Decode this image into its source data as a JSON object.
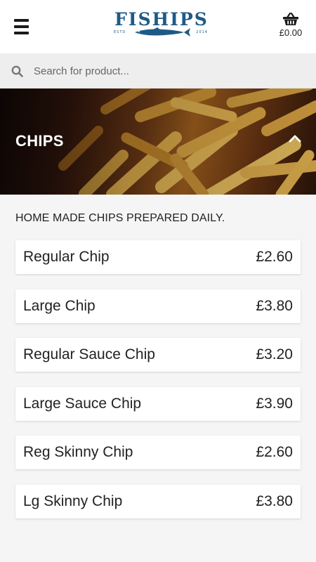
{
  "header": {
    "logo": {
      "name": "FISHIPS",
      "est": "ESTD",
      "year": "2014"
    },
    "cart_total": "£0.00"
  },
  "search": {
    "placeholder": "Search for product..."
  },
  "category": {
    "title": "CHIPS",
    "description": "HOME MADE CHIPS PREPARED DAILY."
  },
  "products": [
    {
      "name": "Regular Chip",
      "price": "£2.60"
    },
    {
      "name": "Large Chip",
      "price": "£3.80"
    },
    {
      "name": "Regular Sauce Chip",
      "price": "£3.20"
    },
    {
      "name": "Large Sauce Chip",
      "price": "£3.90"
    },
    {
      "name": "Reg Skinny Chip",
      "price": "£2.60"
    },
    {
      "name": "Lg Skinny Chip",
      "price": "£3.80"
    }
  ],
  "colors": {
    "brand": "#1f5a86",
    "background": "#f5f5f5",
    "card": "#ffffff"
  },
  "icons": [
    "menu-icon",
    "basket-icon",
    "search-icon",
    "chevron-up-icon",
    "fish-icon"
  ]
}
